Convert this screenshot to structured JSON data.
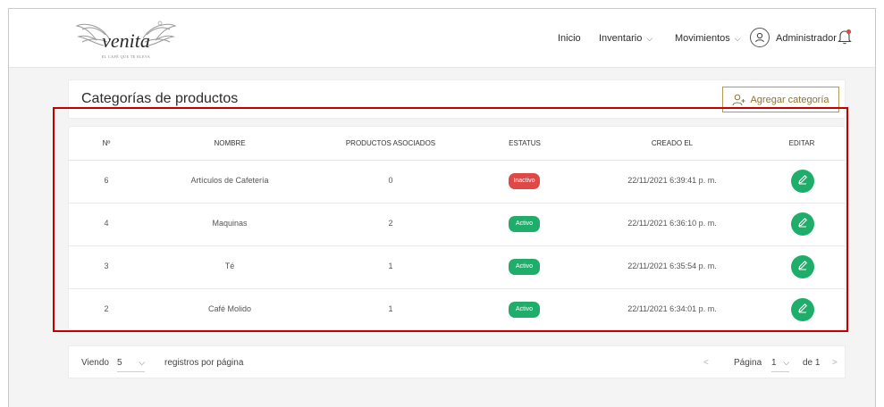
{
  "theme": {
    "accent": "#1fae6a",
    "brand_gold": "#b49a4d",
    "danger": "#e04848",
    "highlight": "#c10000"
  },
  "navbar": {
    "logo_text": "venita",
    "logo_tagline": "EL CAFÉ QUE TE ELEVA",
    "inicio": "Inicio",
    "inventario": "Inventario",
    "movimientos": "Movimientos",
    "user_name": "Administrador",
    "icons": {
      "user": "user-circle-icon",
      "bell": "bell-icon",
      "chevron": "chevron-down-icon"
    }
  },
  "page": {
    "title": "Categorías de productos",
    "add_button": "Agregar categoría"
  },
  "table": {
    "columns": [
      "Nº",
      "NOMBRE",
      "PRODUCTOS ASOCIADOS",
      "ESTATUS",
      "CREADO EL",
      "EDITAR"
    ],
    "rows": [
      {
        "id": "6",
        "name": "Artículos de Cafetería",
        "products": "0",
        "status": "Inactivo",
        "status_color": "#e04848",
        "created": "22/11/2021 6:39:41 p. m."
      },
      {
        "id": "4",
        "name": "Maquinas",
        "products": "2",
        "status": "Activo",
        "status_color": "#1fae6a",
        "created": "22/11/2021 6:36:10 p. m."
      },
      {
        "id": "3",
        "name": "Té",
        "products": "1",
        "status": "Activo",
        "status_color": "#1fae6a",
        "created": "22/11/2021 6:35:54 p. m."
      },
      {
        "id": "2",
        "name": "Café Molido",
        "products": "1",
        "status": "Activo",
        "status_color": "#1fae6a",
        "created": "22/11/2021 6:34:01 p. m."
      }
    ]
  },
  "pagination": {
    "viewing_label": "Viendo",
    "per_page": "5",
    "per_page_suffix": "registros por página",
    "page_label": "Página",
    "current_page": "1",
    "of_label": "de 1",
    "prev": "<",
    "next": ">"
  }
}
